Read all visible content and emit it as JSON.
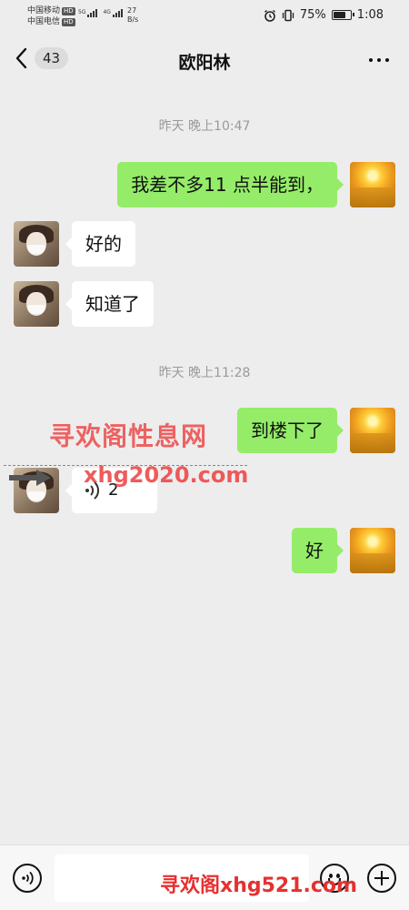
{
  "status_bar": {
    "carrier_1": "中国移动",
    "carrier_2": "中国电信",
    "hd": "HD",
    "signal_1_label": "5G",
    "signal_2_label": "4G",
    "net_speed_value": "27",
    "net_speed_unit": "B/s",
    "battery_percent": "75%",
    "battery_level": 0.75,
    "time": "1:08",
    "icons": [
      "alarm-icon",
      "vibrate-icon",
      "battery-icon"
    ]
  },
  "header": {
    "unread_count": "43",
    "title": "欧阳林"
  },
  "messages": [
    {
      "type": "time",
      "text": "昨天 晚上10:47"
    },
    {
      "type": "msg",
      "sender": "me",
      "text": "我差不多11 点半能到，"
    },
    {
      "type": "msg",
      "sender": "them",
      "text": "好的"
    },
    {
      "type": "msg",
      "sender": "them",
      "text": "知道了"
    },
    {
      "type": "time",
      "text": "昨天 晚上11:28"
    },
    {
      "type": "msg",
      "sender": "me",
      "text": "到楼下了"
    },
    {
      "type": "voice",
      "sender": "them",
      "text": "2"
    },
    {
      "type": "msg",
      "sender": "me",
      "text": "好"
    }
  ],
  "watermarks": {
    "top": "寻欢阁性息网",
    "middle": "xhg2020.com",
    "bottom": "寻欢阁xhg521.com"
  },
  "input": {
    "value": "",
    "placeholder": ""
  },
  "colors": {
    "background": "#ededed",
    "my_bubble": "#95ec69",
    "their_bubble": "#ffffff",
    "watermark": "#ee4a4a"
  }
}
